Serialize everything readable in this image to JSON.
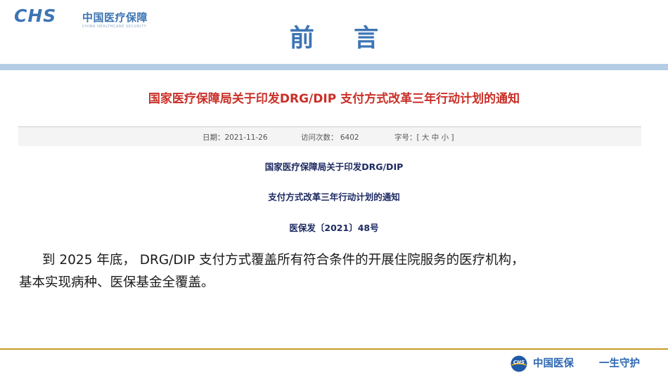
{
  "header": {
    "logo_mark_text": "CHS",
    "logo_cn": "中国医疗保障",
    "logo_en": "CHINA HEALTHCARE SECURITY",
    "title": "前 言"
  },
  "notice": {
    "headline": "国家医疗保障局关于印发DRG/DIP 支付方式改革三年行动计划的通知",
    "meta": {
      "date": "日期：2021-11-26",
      "visits": "访问次数： 6402",
      "font_size": "字号：[ 大 中 小 ]"
    },
    "doc_title_line1": "国家医疗保障局关于印发DRG/DIP",
    "doc_title_line2": "支付方式改革三年行动计划的通知",
    "doc_number": "医保发〔2021〕48号"
  },
  "body": {
    "line1": "到 2025 年底， DRG/DIP 支付方式覆盖所有符合条件的开展住院服务的医疗机构，",
    "line2": "基本实现病种、医保基金全覆盖。"
  },
  "footer": {
    "emblem_text": "CHS",
    "brand": "中国医保",
    "slogan": "一生守护"
  },
  "colors": {
    "brand_blue": "#3d75b4",
    "headline_red": "#c93028",
    "doc_navy": "#1e2b62",
    "band": "#b4cde4",
    "footer_gold": "#c59a2a"
  }
}
